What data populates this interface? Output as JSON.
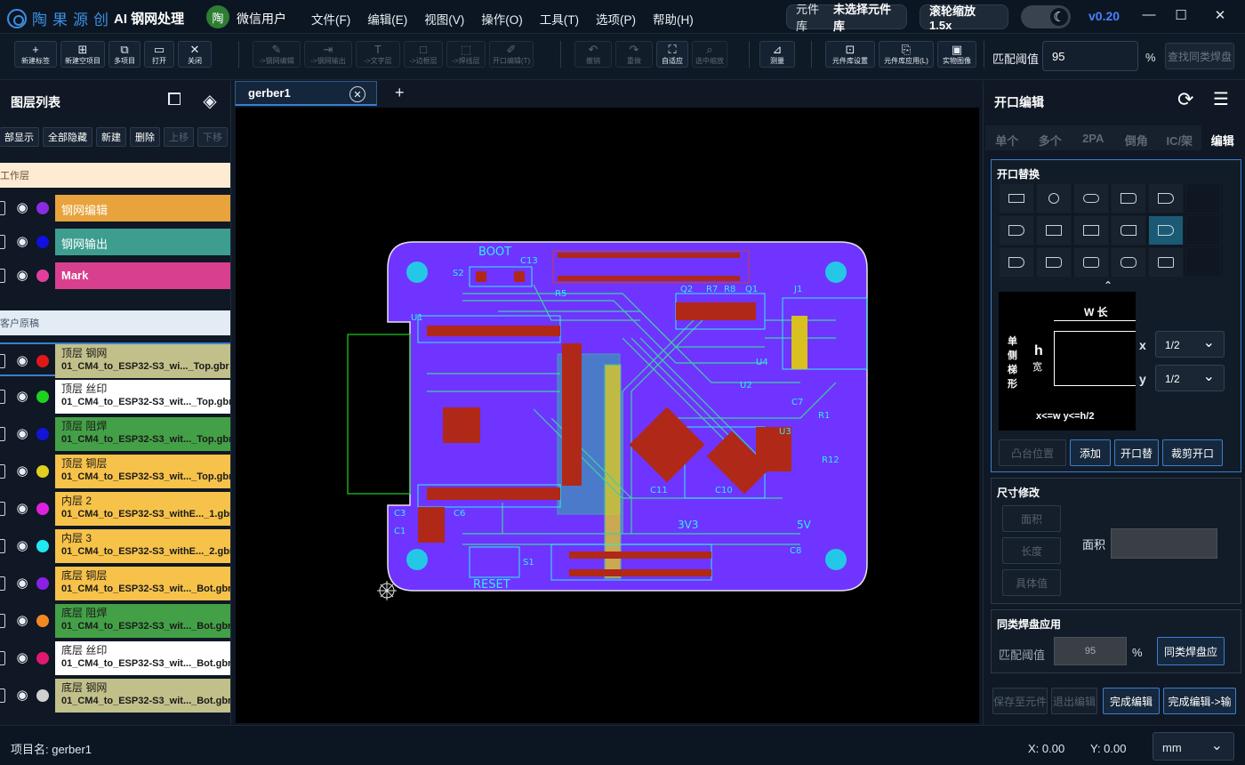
{
  "titlebar": {
    "brand": "陶果源创",
    "app_title": "AI 钢网处理",
    "user_avatar": "陶",
    "user_name": "微信用户",
    "menu": [
      "文件(F)",
      "编辑(E)",
      "视图(V)",
      "操作(O)",
      "工具(T)",
      "选项(P)",
      "帮助(H)"
    ],
    "lib_label": "元件库",
    "lib_value": "未选择元件库",
    "zoom_label": "滚轮缩放 1.5x",
    "version": "v0.20"
  },
  "toolbar": {
    "g1": [
      {
        "icon": "+",
        "label": "新建标签"
      },
      {
        "icon": "⊞",
        "label": "新建空项目"
      },
      {
        "icon": "⧉",
        "label": "多项目"
      },
      {
        "icon": "▭",
        "label": "打开"
      },
      {
        "icon": "✕",
        "label": "关闭"
      }
    ],
    "g2": [
      {
        "icon": "✎",
        "label": "->钢网编辑"
      },
      {
        "icon": "⇥",
        "label": "->钢网输出"
      },
      {
        "icon": "T",
        "label": "->文字层"
      },
      {
        "icon": "□",
        "label": "->边框层"
      },
      {
        "icon": "⬚",
        "label": "->焊线层"
      },
      {
        "icon": "✐",
        "label": "开口编辑(T)"
      }
    ],
    "g3": [
      {
        "icon": "↶",
        "label": "撤销"
      },
      {
        "icon": "↷",
        "label": "重做"
      },
      {
        "icon": "⛶",
        "label": "自适应"
      },
      {
        "icon": "⌕",
        "label": "选中缩放"
      }
    ],
    "g4": [
      {
        "icon": "⊿",
        "label": "测量"
      }
    ],
    "g5": [
      {
        "icon": "⊡",
        "label": "元件库设置"
      },
      {
        "icon": "⎘",
        "label": "元件库应用(L)"
      },
      {
        "icon": "▣",
        "label": "实物图像"
      }
    ],
    "threshold_label": "匹配阈值",
    "threshold_value": "95",
    "threshold_unit": "%",
    "find_same_label": "查找同类焊盘"
  },
  "leftpanel": {
    "title": "图层列表",
    "buttons": [
      "部显示",
      "全部隐藏",
      "新建",
      "删除",
      "上移",
      "下移"
    ],
    "group_work": "工作层",
    "work_layers": [
      {
        "name": "钢网编辑",
        "color": "#8a2be2",
        "bg": "#e8a33c"
      },
      {
        "name": "钢网输出",
        "color": "#1010e0",
        "bg": "#3d9e90"
      },
      {
        "name": "Mark",
        "color": "#e0409a",
        "bg": "#d93f8f"
      }
    ],
    "group_customer": "客户原稿",
    "customer_layers": [
      {
        "name": "顶层 钢网",
        "file": "01_CM4_to_ESP32-S3_wi..._Top.gbr",
        "color": "#e01818",
        "bg": "#c2c08a",
        "fg": "#1a1a1a"
      },
      {
        "name": "顶层 丝印",
        "file": "01_CM4_to_ESP32-S3_wit..._Top.gbr",
        "color": "#1fd020",
        "bg": "#ffffff",
        "fg": "#1a1a1a"
      },
      {
        "name": "顶层 阻焊",
        "file": "01_CM4_to_ESP32-S3_wit..._Top.gbr",
        "color": "#1414d8",
        "bg": "#43a047",
        "fg": "#1a1a1a"
      },
      {
        "name": "顶层 铜层",
        "file": "01_CM4_to_ESP32-S3_wit..._Top.gbr",
        "color": "#e0d020",
        "bg": "#f6c24a",
        "fg": "#1a1a1a"
      },
      {
        "name": "内层 2",
        "file": "01_CM4_to_ESP32-S3_withE..._1.gbr",
        "color": "#e020e0",
        "bg": "#f6c24a",
        "fg": "#1a1a1a"
      },
      {
        "name": "内层 3",
        "file": "01_CM4_to_ESP32-S3_withE..._2.gbr",
        "color": "#20e8f0",
        "bg": "#f6c24a",
        "fg": "#1a1a1a"
      },
      {
        "name": "底层 铜层",
        "file": "01_CM4_to_ESP32-S3_wit..._Bot.gbr",
        "color": "#8a20e8",
        "bg": "#f6c24a",
        "fg": "#1a1a1a"
      },
      {
        "name": "底层 阻焊",
        "file": "01_CM4_to_ESP32-S3_wit..._Bot.gbr",
        "color": "#f08a20",
        "bg": "#43a047",
        "fg": "#1a1a1a"
      },
      {
        "name": "底层 丝印",
        "file": "01_CM4_to_ESP32-S3_wit..._Bot.gbr",
        "color": "#e01870",
        "bg": "#ffffff",
        "fg": "#1a1a1a"
      },
      {
        "name": "底层 钢网",
        "file": "01_CM4_to_ESP32-S3_wit..._Bot.gbr",
        "color": "#d0d0d0",
        "bg": "#c2c08a",
        "fg": "#1a1a1a"
      }
    ]
  },
  "tabs": {
    "file_tab": "gerber1",
    "close": "✕",
    "add": "+"
  },
  "pcb": {
    "labels": [
      "BOOT",
      "S2",
      "C13",
      "J1",
      "Q2",
      "R7",
      "R8",
      "Q1",
      "R5",
      "U1",
      "U4",
      "U2",
      "C7",
      "U3",
      "R12",
      "C11",
      "C10",
      "C3",
      "C6",
      "C1",
      "S1",
      "RESET",
      "3V3",
      "5V",
      "C8",
      "R1"
    ]
  },
  "rightpanel": {
    "title": "开口编辑",
    "tabs": [
      "单个",
      "多个",
      "2PA",
      "倒角",
      "IC/架",
      "编辑"
    ],
    "active_tab": "编辑",
    "replace_title": "开口替换",
    "diagram": {
      "w": "W 长",
      "h": "h",
      "kuan": "宽",
      "side": "单侧梯形",
      "x": "x",
      "y": "y",
      "formula": "x<=w y<=h/2",
      "x_val": "1/2",
      "y_val": "1/2"
    },
    "replace_buttons": [
      "凸台位置",
      "添加",
      "开口替",
      "裁剪开口"
    ],
    "size_title": "尺寸修改",
    "size_buttons": [
      "面积",
      "长度",
      "具体值"
    ],
    "area_label": "面积",
    "area_value": "",
    "same_title": "同类焊盘应用",
    "same_label": "匹配阈值",
    "same_value": "95",
    "same_unit": "%",
    "same_apply": "同类焊盘应",
    "bottom_buttons": [
      "保存至元件",
      "退出编辑",
      "完成编辑",
      "完成编辑->输"
    ]
  },
  "statusbar": {
    "project": "项目名: gerber1",
    "x": "X: 0.00",
    "y": "Y: 0.00",
    "unit": "mm"
  }
}
